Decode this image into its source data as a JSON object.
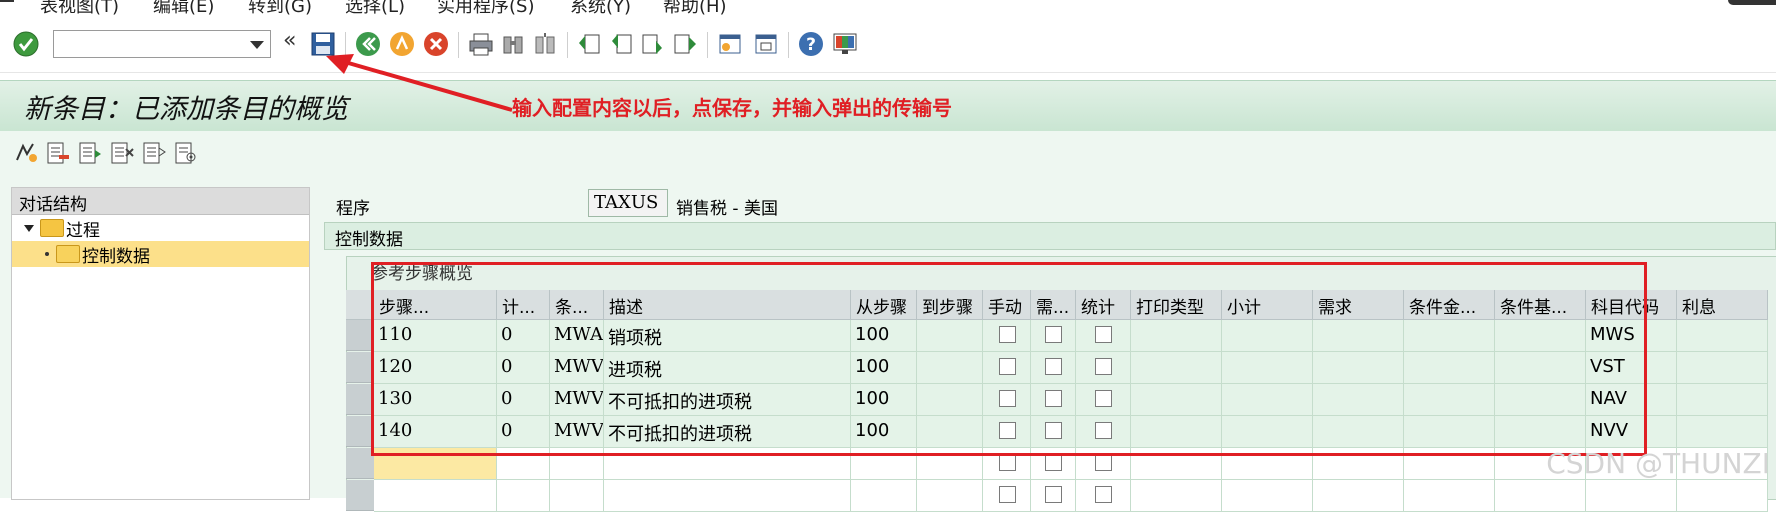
{
  "menu": {
    "items": [
      "表视图(T)",
      "编辑(E)",
      "转到(G)",
      "选择(L)",
      "实用程序(S)",
      "系统(Y)",
      "帮助(H)"
    ]
  },
  "toolbar": {
    "command_field": {
      "value": "",
      "placeholder": ""
    },
    "icons": [
      "check-icon",
      "save-icon",
      "back-icon",
      "exit-icon",
      "cancel-icon",
      "print-icon",
      "find-icon",
      "find-next-icon",
      "first-page-icon",
      "prev-page-icon",
      "next-page-icon",
      "last-page-icon",
      "new-session-icon",
      "shortcut-icon",
      "help-icon",
      "layout-icon"
    ]
  },
  "title": "新条目：已添加条目的概览",
  "annotation": {
    "text": "输入配置内容以后，点保存，并输入弹出的传输号",
    "color": "#e01f24"
  },
  "tree": {
    "header": "对话结构",
    "items": [
      {
        "label": "过程",
        "level": 0,
        "expanded": true,
        "selected": false
      },
      {
        "label": "控制数据",
        "level": 1,
        "selected": true
      }
    ]
  },
  "procedure": {
    "label": "程序",
    "value": "TAXUS",
    "description": "销售税 - 美国"
  },
  "section": {
    "title": "控制数据"
  },
  "steps": {
    "title": "参考步骤概览",
    "columns": [
      "步骤...",
      "计...",
      "条...",
      "描述",
      "从步骤",
      "到步骤",
      "手动",
      "需...",
      "统计",
      "打印类型",
      "小计",
      "需求",
      "条件金...",
      "条件基...",
      "科目代码",
      "利息"
    ],
    "rows": [
      {
        "step": "110",
        "counter": "0",
        "cond": "MWAS",
        "desc": "销项税",
        "from": "100",
        "to": "",
        "manual": false,
        "required": false,
        "stat": false,
        "print": "",
        "subtotal": "",
        "req": "",
        "calc": "",
        "base": "",
        "account": "MWS",
        "interest": ""
      },
      {
        "step": "120",
        "counter": "0",
        "cond": "MWVS",
        "desc": "进项税",
        "from": "100",
        "to": "",
        "manual": false,
        "required": false,
        "stat": false,
        "print": "",
        "subtotal": "",
        "req": "",
        "calc": "",
        "base": "",
        "account": "VST",
        "interest": ""
      },
      {
        "step": "130",
        "counter": "0",
        "cond": "MWVN",
        "desc": "不可抵扣的进项税",
        "from": "100",
        "to": "",
        "manual": false,
        "required": false,
        "stat": false,
        "print": "",
        "subtotal": "",
        "req": "",
        "calc": "",
        "base": "",
        "account": "NAV",
        "interest": ""
      },
      {
        "step": "140",
        "counter": "0",
        "cond": "MWVZ",
        "desc": "不可抵扣的进项税",
        "from": "100",
        "to": "",
        "manual": false,
        "required": false,
        "stat": false,
        "print": "",
        "subtotal": "",
        "req": "",
        "calc": "",
        "base": "",
        "account": "NVV",
        "interest": ""
      }
    ]
  },
  "watermark": "CSDN @THUNZI",
  "colors": {
    "accent": "#e01f24",
    "header_band": "#c9e5d2",
    "selected": "#fce08a"
  }
}
